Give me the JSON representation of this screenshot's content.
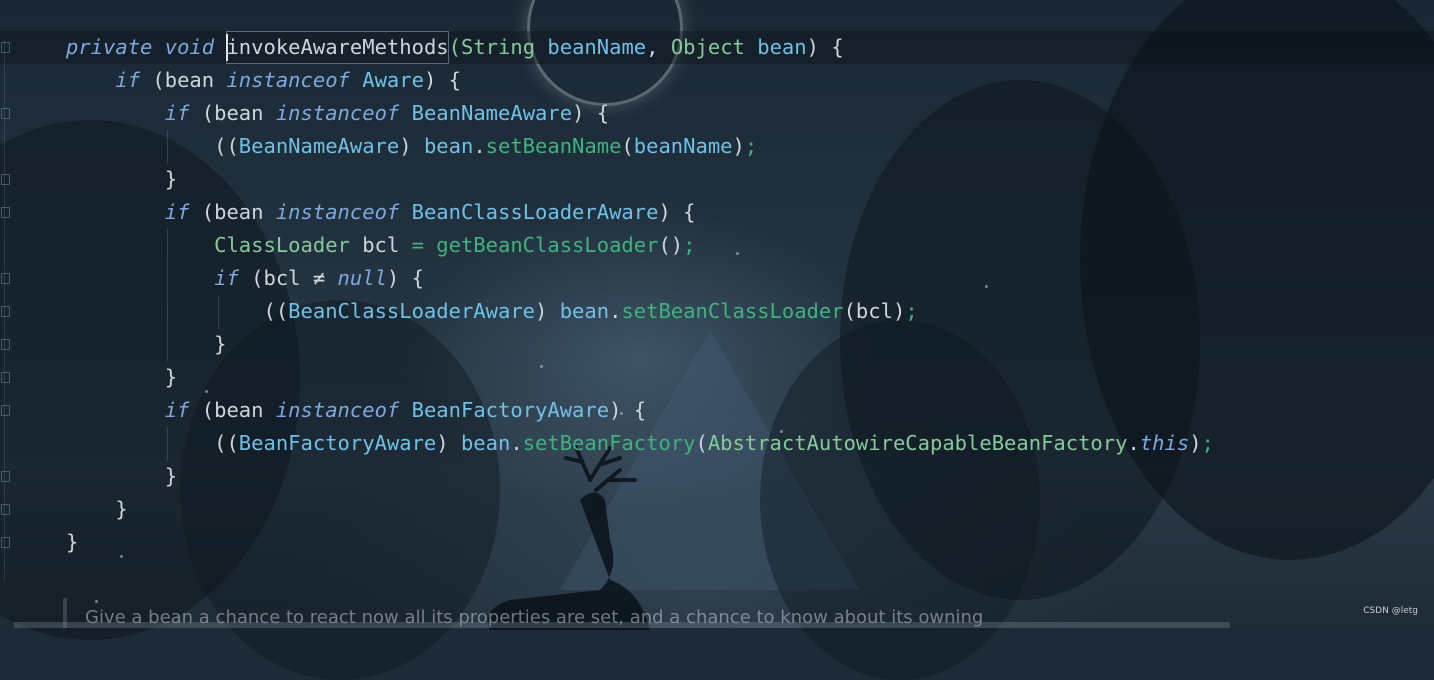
{
  "editor": {
    "lines": [
      [
        [
          "kw",
          "private"
        ],
        [
          "pl",
          " "
        ],
        [
          "kw",
          "void"
        ],
        [
          "pl",
          " "
        ],
        [
          "cursor",
          "invokeAwareMethods"
        ],
        [
          "cls",
          "("
        ],
        [
          "cls",
          "String"
        ],
        [
          "pl",
          " "
        ],
        [
          "ty",
          "beanName"
        ],
        [
          "pl",
          ", "
        ],
        [
          "cls",
          "Object"
        ],
        [
          "pl",
          " "
        ],
        [
          "ty",
          "bean"
        ],
        [
          "pl",
          ") {"
        ]
      ],
      [
        [
          "pl",
          "    "
        ],
        [
          "kw",
          "if"
        ],
        [
          "pl",
          " (bean "
        ],
        [
          "kw",
          "instanceof"
        ],
        [
          "pl",
          " "
        ],
        [
          "ty",
          "Aware"
        ],
        [
          "pl",
          ") {"
        ]
      ],
      [
        [
          "pl",
          "        "
        ],
        [
          "kw",
          "if"
        ],
        [
          "pl",
          " (bean "
        ],
        [
          "kw",
          "instanceof"
        ],
        [
          "pl",
          " "
        ],
        [
          "ty",
          "BeanNameAware"
        ],
        [
          "pl",
          ") {"
        ]
      ],
      [
        [
          "pl",
          "            (("
        ],
        [
          "ty",
          "BeanNameAware"
        ],
        [
          "pl",
          ") "
        ],
        [
          "ty",
          "bean"
        ],
        [
          "pl",
          "."
        ],
        [
          "fn",
          "setBeanName"
        ],
        [
          "pl",
          "("
        ],
        [
          "ty",
          "beanName"
        ],
        [
          "pl",
          ")"
        ],
        [
          "semi",
          ";"
        ]
      ],
      [
        [
          "pl",
          "        }"
        ]
      ],
      [
        [
          "pl",
          "        "
        ],
        [
          "kw",
          "if"
        ],
        [
          "pl",
          " (bean "
        ],
        [
          "kw",
          "instanceof"
        ],
        [
          "pl",
          " "
        ],
        [
          "ty",
          "BeanClassLoaderAware"
        ],
        [
          "pl",
          ") {"
        ]
      ],
      [
        [
          "pl",
          "            "
        ],
        [
          "cls",
          "ClassLoader"
        ],
        [
          "pl",
          " bcl "
        ],
        [
          "fn",
          "="
        ],
        [
          "pl",
          " "
        ],
        [
          "fn",
          "getBeanClassLoader"
        ],
        [
          "pl",
          "()"
        ],
        [
          "semi",
          ";"
        ]
      ],
      [
        [
          "pl",
          "            "
        ],
        [
          "kw",
          "if"
        ],
        [
          "pl",
          " (bcl "
        ],
        [
          "pl",
          "≠"
        ],
        [
          "pl",
          " "
        ],
        [
          "kw",
          "null"
        ],
        [
          "pl",
          ") {"
        ]
      ],
      [
        [
          "pl",
          "                (("
        ],
        [
          "ty",
          "BeanClassLoaderAware"
        ],
        [
          "pl",
          ") "
        ],
        [
          "ty",
          "bean"
        ],
        [
          "pl",
          "."
        ],
        [
          "fn",
          "setBeanClassLoader"
        ],
        [
          "pl",
          "(bcl)"
        ],
        [
          "semi",
          ";"
        ]
      ],
      [
        [
          "pl",
          "            }"
        ]
      ],
      [
        [
          "pl",
          "        }"
        ]
      ],
      [
        [
          "pl",
          "        "
        ],
        [
          "kw",
          "if"
        ],
        [
          "pl",
          " (bean "
        ],
        [
          "kw",
          "instanceof"
        ],
        [
          "pl",
          " "
        ],
        [
          "ty",
          "BeanFactoryAware"
        ],
        [
          "pl",
          ") {"
        ]
      ],
      [
        [
          "pl",
          "            (("
        ],
        [
          "ty",
          "BeanFactoryAware"
        ],
        [
          "pl",
          ") "
        ],
        [
          "ty",
          "bean"
        ],
        [
          "pl",
          "."
        ],
        [
          "fn",
          "setBeanFactory"
        ],
        [
          "pl",
          "("
        ],
        [
          "cls",
          "AbstractAutowireCapableBeanFactory"
        ],
        [
          "pl",
          "."
        ],
        [
          "kw",
          "this"
        ],
        [
          "pl",
          ")"
        ],
        [
          "semi",
          ";"
        ]
      ],
      [
        [
          "pl",
          "        }"
        ]
      ],
      [
        [
          "pl",
          "    }"
        ]
      ],
      [
        [
          "pl",
          "}"
        ]
      ]
    ],
    "doc_comment": "Give a bean a chance to react now all its properties are set, and a chance to know about its owning"
  },
  "watermark": "CSDN @letg",
  "colors": {
    "keyword": "#7ea8de",
    "type": "#6fc1e6",
    "class": "#86c99a",
    "method": "#3fb37f",
    "plain": "#cdd6e0"
  }
}
